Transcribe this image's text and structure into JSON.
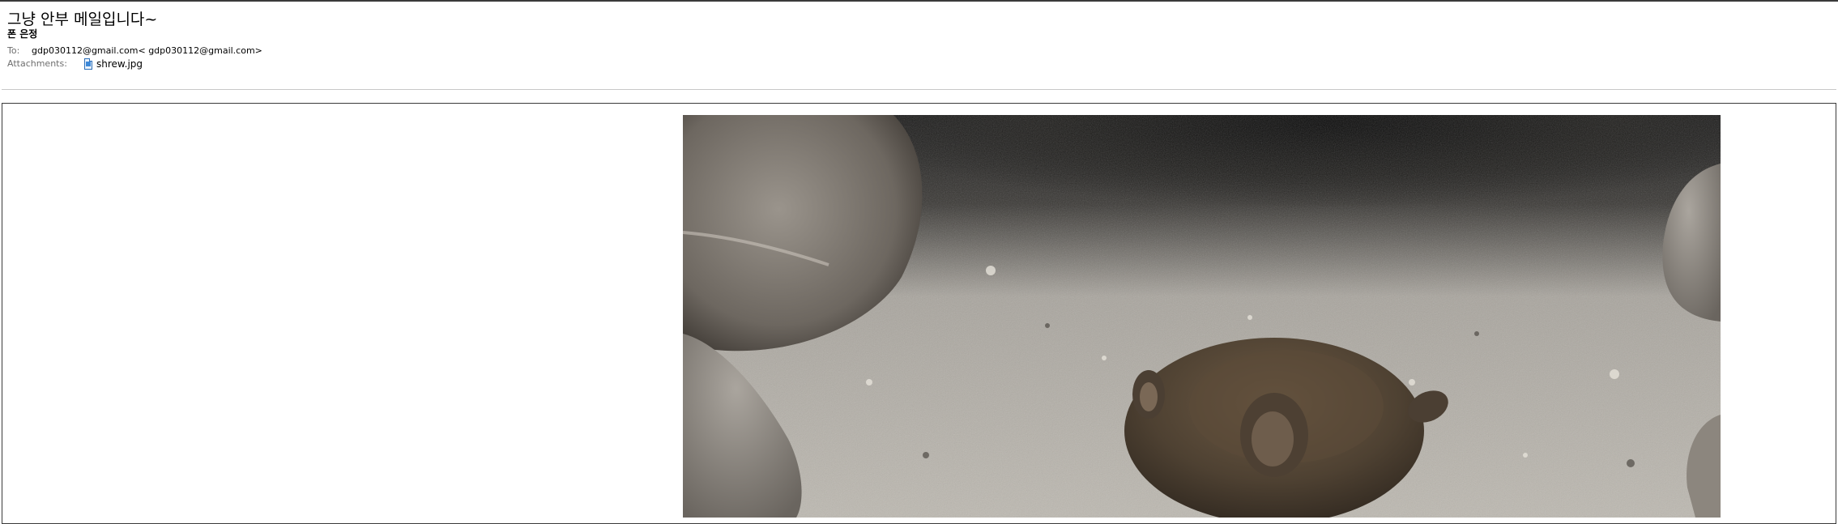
{
  "email": {
    "subject": "그냥 안부 메일입니다~",
    "sender": "폰 은정",
    "to_label": "To:",
    "to_value": "gdp030112@gmail.com< gdp030112@gmail.com>",
    "attachments_label": "Attachments:",
    "attachment": {
      "file_name": "shrew.jpg",
      "icon": "image-file-icon"
    }
  },
  "body": {
    "image": {
      "subject": "shrew photo",
      "icon": "shrew-photo"
    }
  }
}
